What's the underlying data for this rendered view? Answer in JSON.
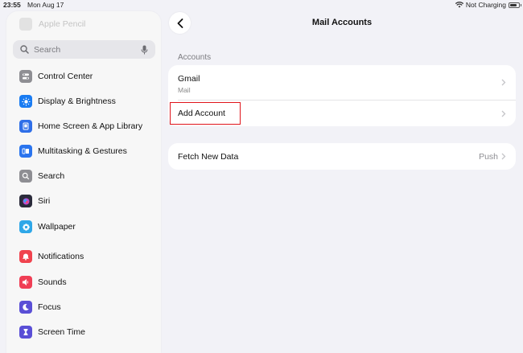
{
  "status": {
    "time": "23:55",
    "date": "Mon Aug 17",
    "charging": "Not Charging"
  },
  "sidebar": {
    "faded_item": "Apple Pencil",
    "search_placeholder": "Search",
    "items": [
      {
        "label": "Control Center",
        "icon": "switches-icon",
        "color": "#8e8e93"
      },
      {
        "label": "Display & Brightness",
        "icon": "sun-icon",
        "color": "#1a7cf2"
      },
      {
        "label": "Home Screen & App Library",
        "icon": "home-screen-icon",
        "color": "#2f6fe8"
      },
      {
        "label": "Multitasking & Gestures",
        "icon": "multitasking-icon",
        "color": "#2a74ee"
      },
      {
        "label": "Search",
        "icon": "magnifier-icon",
        "color": "#8e8e93"
      },
      {
        "label": "Siri",
        "icon": "siri-icon",
        "color": "#2b2b3b"
      },
      {
        "label": "Wallpaper",
        "icon": "flower-icon",
        "color": "#2ea7e8"
      },
      {
        "label": "Notifications",
        "icon": "bell-icon",
        "color": "#f0434e"
      },
      {
        "label": "Sounds",
        "icon": "speaker-icon",
        "color": "#f03e55"
      },
      {
        "label": "Focus",
        "icon": "moon-icon",
        "color": "#5a4fd6"
      },
      {
        "label": "Screen Time",
        "icon": "hourglass-icon",
        "color": "#5a4fd6"
      }
    ]
  },
  "main": {
    "title": "Mail Accounts",
    "section_header": "Accounts",
    "account": {
      "name": "Gmail",
      "type": "Mail"
    },
    "add_account": "Add Account",
    "fetch": {
      "label": "Fetch New Data",
      "value": "Push"
    }
  },
  "colors": {
    "highlight": "#e0141b",
    "background": "#f2f2f7"
  }
}
